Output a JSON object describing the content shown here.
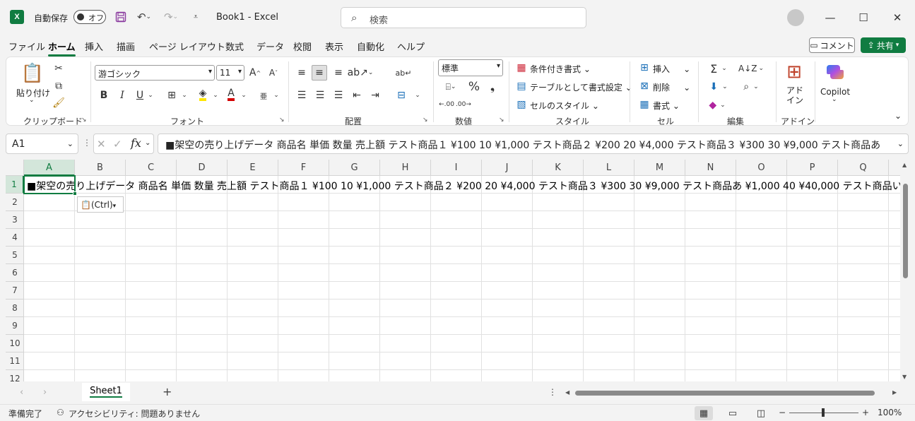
{
  "titlebar": {
    "app_icon": "X",
    "autosave_label": "自動保存",
    "autosave_state": "オフ",
    "doc_title": "Book1  -  Excel",
    "search_placeholder": "検索"
  },
  "menu": {
    "tabs": [
      "ファイル",
      "ホーム",
      "挿入",
      "描画",
      "ページ レイアウト",
      "数式",
      "データ",
      "校閲",
      "表示",
      "自動化",
      "ヘルプ"
    ],
    "active_tab": "ホーム",
    "comment_label": "コメント",
    "share_label": "共有"
  },
  "ribbon": {
    "clipboard": {
      "paste_label": "貼り付け",
      "group_label": "クリップボード"
    },
    "font": {
      "font_name": "游ゴシック",
      "font_size": "11",
      "group_label": "フォント",
      "bold": "B",
      "italic": "I",
      "underline": "U"
    },
    "alignment": {
      "group_label": "配置"
    },
    "number": {
      "format": "標準",
      "group_label": "数値"
    },
    "styles": {
      "conditional": "条件付き書式",
      "as_table": "テーブルとして書式設定",
      "cell_styles": "セルのスタイル",
      "group_label": "スタイル"
    },
    "cells": {
      "insert": "挿入",
      "delete": "削除",
      "format": "書式",
      "group_label": "セル"
    },
    "editing": {
      "group_label": "編集"
    },
    "addins": {
      "label": "アド\nイン",
      "group_label": "アドイン"
    },
    "copilot": {
      "label": "Copilot"
    }
  },
  "formula_bar": {
    "name_box": "A1",
    "content": "■架空の売り上げデータ 商品名 単価 数量 売上額 テスト商品１ ¥100 10 ¥1,000 テスト商品２ ¥200 20 ¥4,000 テスト商品３ ¥300 30 ¥9,000 テスト商品あ"
  },
  "grid": {
    "columns": [
      "A",
      "B",
      "C",
      "D",
      "E",
      "F",
      "G",
      "H",
      "I",
      "J",
      "K",
      "L",
      "M",
      "N",
      "O",
      "P",
      "Q"
    ],
    "rows": [
      "1",
      "2",
      "3",
      "4",
      "5",
      "6",
      "7",
      "8",
      "9",
      "10",
      "11",
      "12"
    ],
    "a1_text": "■架空の売り上げデータ 商品名 単価 数量 売上額 テスト商品１ ¥100 10 ¥1,000 テスト商品２ ¥200 20 ¥4,000 テスト商品３ ¥300 30 ¥9,000 テスト商品あ ¥1,000 40 ¥40,000 テスト商品い",
    "paste_options": "(Ctrl)"
  },
  "sheets": {
    "tabs": [
      "Sheet1"
    ],
    "add": "+"
  },
  "status": {
    "ready": "準備完了",
    "accessibility": "アクセシビリティ: 問題ありません",
    "zoom": "100%"
  },
  "colors": {
    "accent": "#107c41"
  }
}
